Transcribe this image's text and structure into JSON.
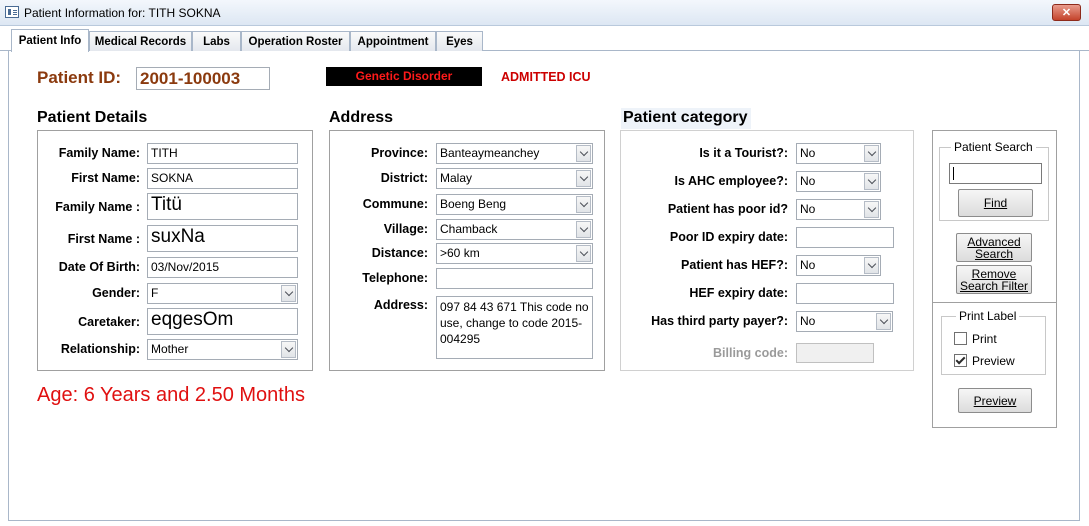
{
  "window": {
    "title": "Patient Information for: TITH SOKNA",
    "close_label": "✕"
  },
  "tabs": [
    "Patient Info",
    "Medical Records",
    "Labs",
    "Operation Roster",
    "Appointment",
    "Eyes"
  ],
  "header": {
    "patient_id_label": "Patient ID:",
    "patient_id": "2001-100003",
    "genetic_badge": "Genetic Disorder",
    "status": "ADMITTED ICU"
  },
  "details": {
    "title": "Patient Details",
    "family_name_label": "Family Name:",
    "family_name": "TITH",
    "first_name_label": "First Name:",
    "first_name": "SOKNA",
    "family_name_local_label": "Family Name :",
    "family_name_local": "Titü",
    "first_name_local_label": "First Name :",
    "first_name_local": "suxNa",
    "dob_label": "Date Of Birth:",
    "dob": "03/Nov/2015",
    "gender_label": "Gender:",
    "gender": "F",
    "caretaker_label": "Caretaker:",
    "caretaker": "eqgesOm",
    "relationship_label": "Relationship:",
    "relationship": "Mother"
  },
  "age_text": "Age: 6 Years and 2.50 Months",
  "address": {
    "title": "Address",
    "province_label": "Province:",
    "province": "Banteaymeanchey",
    "district_label": "District:",
    "district": "Malay",
    "commune_label": "Commune:",
    "commune": "Boeng Beng",
    "village_label": "Village:",
    "village": "Chamback",
    "distance_label": "Distance:",
    "distance": ">60 km",
    "telephone_label": "Telephone:",
    "telephone": "",
    "address_label": "Address:",
    "address_text": "097 84 43 671 This code no use, change to code 2015-004295"
  },
  "category": {
    "title": "Patient category",
    "tourist_label": "Is it a Tourist?:",
    "tourist": "No",
    "ahc_label": "Is AHC employee?:",
    "ahc": "No",
    "poor_id_label": "Patient has poor id?",
    "poor_id": "No",
    "poor_id_expiry_label": "Poor ID expiry date:",
    "poor_id_expiry": "",
    "hef_label": "Patient has HEF?:",
    "hef": "No",
    "hef_expiry_label": "HEF expiry date:",
    "hef_expiry": "",
    "third_party_label": "Has third party payer?:",
    "third_party": "No",
    "billing_code_label": "Billing code:",
    "billing_code": ""
  },
  "search": {
    "title": "Patient Search",
    "find_label": "Find",
    "advanced_line1": "Advanced",
    "advanced_line2": "Search",
    "remove_line1": "Remove",
    "remove_line2": "Search Filter"
  },
  "print": {
    "title": "Print Label",
    "print_label": "Print",
    "print_checked": false,
    "preview_label": "Preview",
    "preview_checked": true,
    "preview_button": "Preview"
  },
  "colors": {
    "label_brown": "#8b3a0e",
    "status_red": "#cc0000",
    "age_red": "#e01010",
    "badge_bg": "#000000",
    "badge_text": "#ff1a1a"
  }
}
